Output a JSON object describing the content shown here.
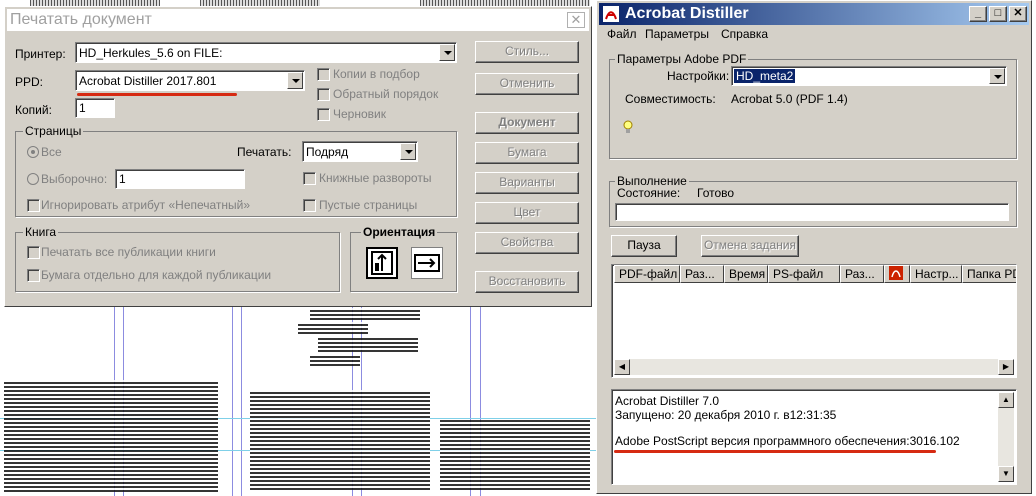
{
  "print_dialog": {
    "title": "Печатать документ",
    "printer_label": "Принтер:",
    "printer_value": "HD_Herkules_5.6 on FILE:",
    "ppd_label": "PPD:",
    "ppd_value": "Acrobat Distiller 2017.801",
    "copies_label": "Копий:",
    "copies_value": "1",
    "collate_label": "Копии в подбор",
    "reverse_label": "Обратный порядок",
    "draft_label": "Черновик",
    "pages_group": "Страницы",
    "all_label": "Все",
    "selective_label": "Выборочно:",
    "selective_value": "1",
    "print_label": "Печатать:",
    "print_value": "Подряд",
    "spreads_label": "Книжные развороты",
    "ignore_label": "Игнорировать атрибут «Непечатный»",
    "blank_label": "Пустые страницы",
    "book_group": "Книга",
    "print_all_label": "Печатать все публикации книги",
    "paper_each_label": "Бумага отдельно для каждой публикации",
    "orientation_group": "Ориентация",
    "buttons": {
      "style": "Стиль...",
      "cancel": "Отменить",
      "document": "Документ",
      "paper": "Бумага",
      "options": "Варианты",
      "color": "Цвет",
      "properties": "Свойства",
      "restore": "Восстановить"
    }
  },
  "distiller": {
    "title": "Acrobat Distiller",
    "menu": [
      "Файл",
      "Параметры",
      "Справка"
    ],
    "params_group": "Параметры Adobe PDF",
    "settings_label": "Настройки:",
    "settings_value": "HD_meta2",
    "compat_label": "Совместимость:",
    "compat_value": "Acrobat 5.0 (PDF 1.4)",
    "progress_group": "Выполнение",
    "status_label": "Состояние:",
    "status_value": "Готово",
    "pause_button": "Пауза",
    "cancel_job_button": "Отмена задания",
    "columns": [
      "PDF-файл",
      "Раз...",
      "Время",
      "PS-файл",
      "Раз...",
      "",
      "Настр...",
      "Папка PDF"
    ],
    "log": [
      "Acrobat Distiller 7.0",
      "Запущено: 20 декабря 2010 г. в12:31:35",
      "",
      "Adobe PostScript версия программного обеспечения:3016.102"
    ]
  },
  "colors": {
    "dialog_bg": "#d4d0c8",
    "active_title": "#0a246a",
    "highlight": "#0a246a",
    "annotation_red": "#d62a12"
  }
}
